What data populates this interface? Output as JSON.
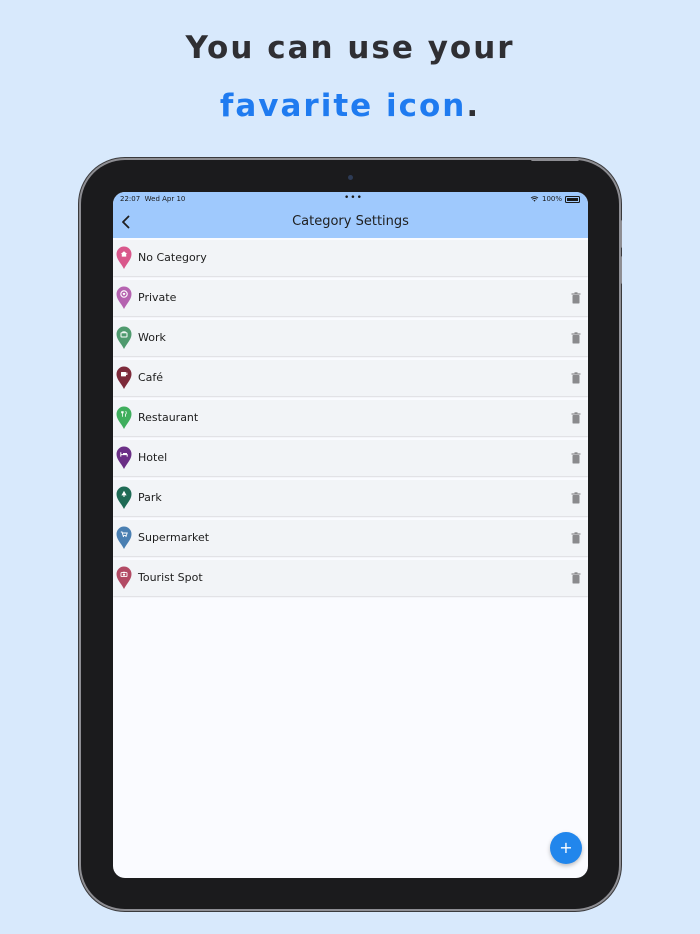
{
  "promo": {
    "line1": "You can use your",
    "line2_accent": "favarite icon",
    "line2_tail": "."
  },
  "status_bar": {
    "time": "22:07",
    "date": "Wed Apr 10",
    "dots": "•••",
    "battery": "100%"
  },
  "nav": {
    "back_icon": "chevron-left-icon",
    "title": "Category Settings"
  },
  "categories": [
    {
      "label": "No Category",
      "pin_color": "#d9578b",
      "icon": "home-icon",
      "deletable": false
    },
    {
      "label": "Private",
      "pin_color": "#b563b0",
      "icon": "heart-icon",
      "deletable": true
    },
    {
      "label": "Work",
      "pin_color": "#4f9a6e",
      "icon": "briefcase-icon",
      "deletable": true
    },
    {
      "label": "Café",
      "pin_color": "#7d2a3a",
      "icon": "coffee-icon",
      "deletable": true
    },
    {
      "label": "Restaurant",
      "pin_color": "#3fae5d",
      "icon": "cutlery-icon",
      "deletable": true
    },
    {
      "label": "Hotel",
      "pin_color": "#6b2f86",
      "icon": "bed-icon",
      "deletable": true
    },
    {
      "label": "Park",
      "pin_color": "#1f6b55",
      "icon": "tree-icon",
      "deletable": true
    },
    {
      "label": "Supermarket",
      "pin_color": "#4a7fb2",
      "icon": "cart-icon",
      "deletable": true
    },
    {
      "label": "Tourist Spot",
      "pin_color": "#b24a64",
      "icon": "camera-icon",
      "deletable": true
    }
  ],
  "fab": {
    "label": "+",
    "icon": "add-icon"
  },
  "colors": {
    "background": "#d8e9fc",
    "accent": "#1f7bf0",
    "topbar": "#9fc9fd",
    "row": "#f2f4f7",
    "fab": "#2186ec"
  }
}
